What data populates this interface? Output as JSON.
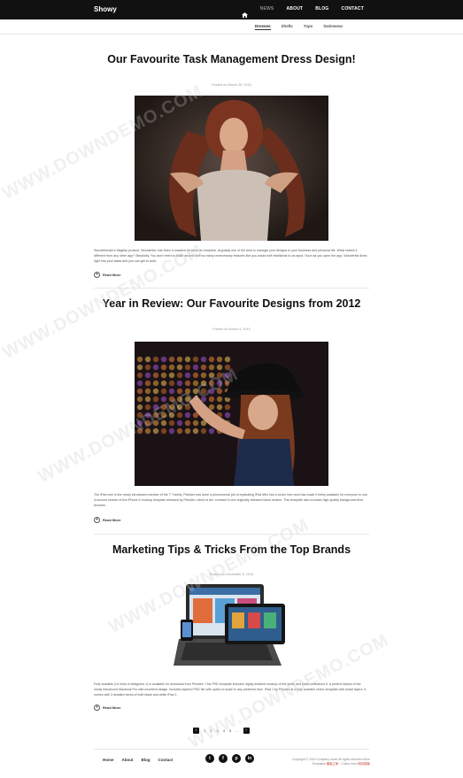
{
  "header": {
    "brand": "Showy",
    "nav": [
      {
        "label": "NEWS",
        "active": true
      },
      {
        "label": "ABOUT",
        "active": false
      },
      {
        "label": "BLOG",
        "active": false
      },
      {
        "label": "CONTACT",
        "active": false
      }
    ]
  },
  "subnav": [
    "Dresses",
    "Shells",
    "Tops",
    "Swimwear"
  ],
  "posts": [
    {
      "title": "Our Favourite Task Management Dress Design!",
      "date": "Posted on March 26, 2015",
      "excerpt": "Wunderkinder's flagship product, Wunderlist, has been a massive hit since its inception. Arguably one of the best to manage your designs in your business and personal life. What makes it different from any other app? Simplicity. You don't need to fiddle around with so many unnecessary features like you would with traditional to-do apps. Soon as you open the app, Wunderlist dives right into your tasks and you can get to work.",
      "read_more": "Read More"
    },
    {
      "title": "Year in Review: Our Favourite Designs from 2012",
      "date": "Posted on March 3, 2015",
      "excerpt": "The iPad mini is the newly introduced member of the 7\" Family. Pixeden has done a phenomenal job of replicating iPad Mini into a vector form and has made it freely available for everyone to use. A second version of the iPhone 5 mockup template released by Pixeden, which is the 'contrast' to the originally released black version. This template also includes high quality background floor textures.",
      "read_more": "Read More"
    },
    {
      "title": "Marketing Tips & Tricks From the Top Brands",
      "date": "Posted on December 8, 2015",
      "excerpt": "Fully scalable (14 mins of designers 1) is available for download from Pixeden. This PSD template includes highly detailed mockup of the white and black collections 5. A perfect replica of the newly introduced Macbook Pro with excellent design. Includes layered PSD file with option to scale to any preferred size. iPad 1 by Pixeden is a fully scalable vector template with smart layers. It comes with 3 detailed views of both black and white iPad 1.",
      "read_more": "Read More"
    }
  ],
  "pagination": {
    "prev": "‹",
    "pages": [
      "1",
      "2",
      "3",
      "4",
      "5",
      "..."
    ],
    "next": "›"
  },
  "footer": {
    "links": [
      "Home",
      "About",
      "Blog",
      "Contact"
    ],
    "socials": [
      {
        "icon": "twitter-icon",
        "glyph": "t"
      },
      {
        "icon": "facebook-icon",
        "glyph": "f"
      },
      {
        "icon": "pinterest-icon",
        "glyph": "p"
      },
      {
        "icon": "linkedin-icon",
        "glyph": "in"
      }
    ],
    "copyright": "Copyright © 2015 Company name All rights reserved.More Templates",
    "copyright_link1": "模板之家",
    "copyright_mid": " - Collect from",
    "copyright_link2": "网页模板"
  },
  "watermark": "WWW.DOWNDEMO.COM",
  "colors": {
    "topbar": "#111111",
    "accent": "#c0392b"
  }
}
